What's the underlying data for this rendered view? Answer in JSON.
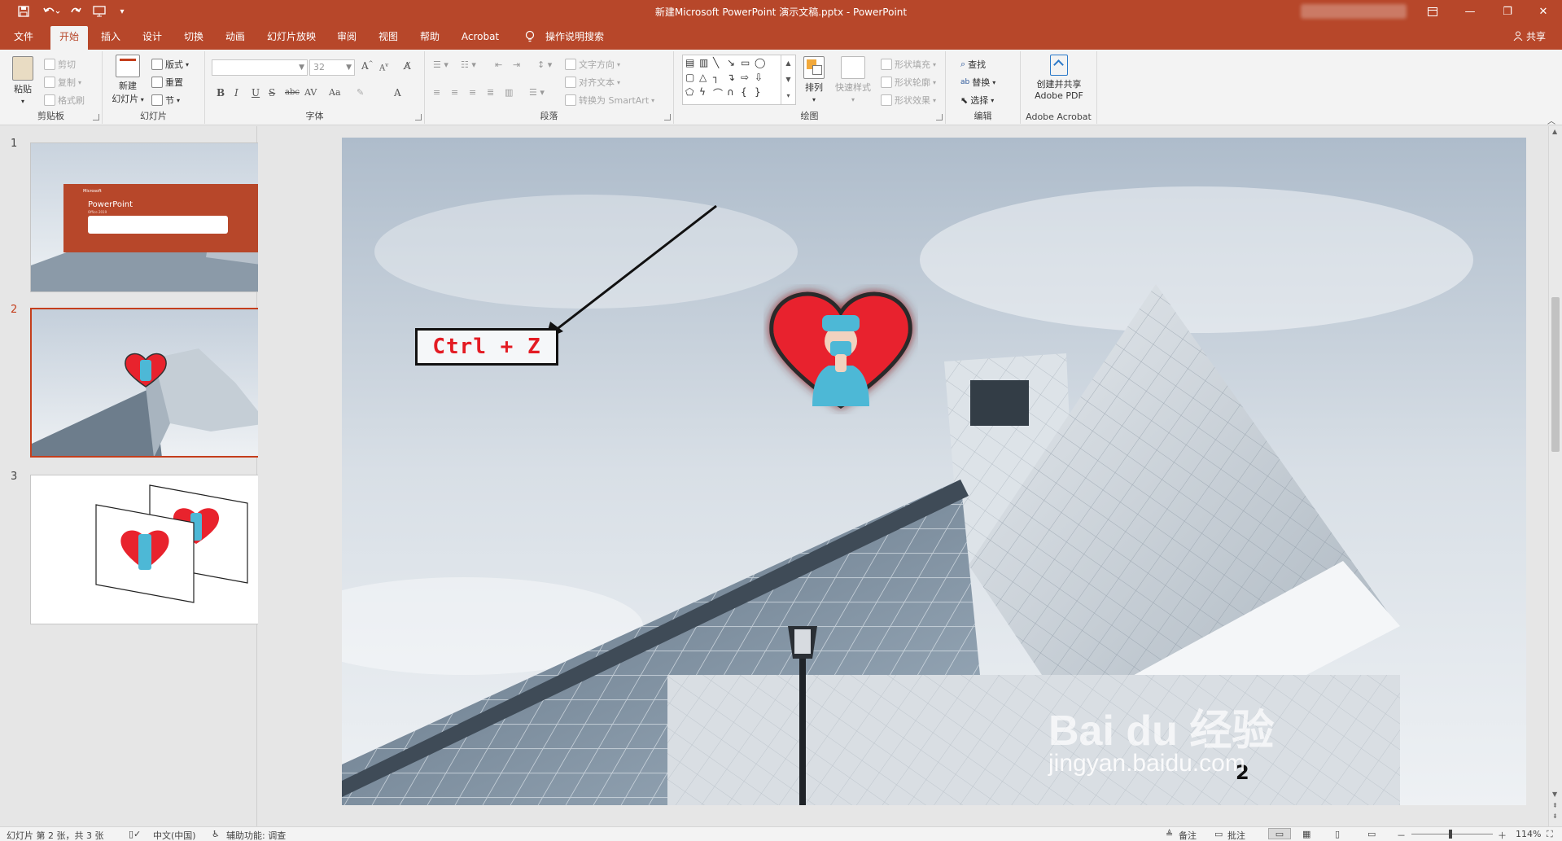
{
  "window": {
    "title": "新建Microsoft PowerPoint 演示文稿.pptx  -  PowerPoint",
    "icons": [
      "save-icon",
      "undo-icon",
      "redo-icon",
      "present-from-start-icon",
      "customize-qat-icon",
      "ribbon-display-icon",
      "minimize-icon",
      "restore-icon",
      "close-icon"
    ],
    "minimize": "—",
    "restore": "❐",
    "close": "✕"
  },
  "tabs": [
    "文件",
    "开始",
    "插入",
    "设计",
    "切换",
    "动画",
    "幻灯片放映",
    "审阅",
    "视图",
    "帮助",
    "Acrobat",
    "操作说明搜索"
  ],
  "active_tab": "开始",
  "share_label": "共享",
  "ribbon": {
    "clipboard": {
      "paste": "粘贴",
      "cut": "剪切",
      "copy": "复制",
      "format_painter": "格式刷",
      "label": "剪贴板"
    },
    "slides": {
      "new_slide_line1": "新建",
      "new_slide_line2": "幻灯片",
      "layout": "版式",
      "reset": "重置",
      "section": "节",
      "label": "幻灯片"
    },
    "font": {
      "font_name": "",
      "font_size": "32",
      "label": "字体",
      "buttons": [
        "B",
        "I",
        "U",
        "S",
        "abc",
        "AV",
        "Aa",
        "A"
      ]
    },
    "paragraph": {
      "text_direction": "文字方向",
      "align_text": "对齐文本",
      "convert_smartart": "转换为 SmartArt",
      "label": "段落"
    },
    "drawing": {
      "arrange": "排列",
      "quick_styles": "快速样式",
      "shape_fill": "形状填充",
      "shape_outline": "形状轮廓",
      "shape_effects": "形状效果",
      "label": "绘图"
    },
    "editing": {
      "find": "查找",
      "replace": "替换",
      "select": "选择",
      "label": "编辑"
    },
    "acrobat": {
      "create_line1": "创建并共享",
      "create_line2": "Adobe PDF",
      "label": "Adobe Acrobat"
    }
  },
  "thumbnails": [
    {
      "number": "1",
      "title": "PowerPoint",
      "subtitle": "Office 2019",
      "brand": "Microsoft",
      "selected": false
    },
    {
      "number": "2",
      "selected": true
    },
    {
      "number": "3",
      "selected": false
    }
  ],
  "slide": {
    "shortcut_text": "Ctrl + Z",
    "page_number": "2",
    "watermark_logo": "Bai du 经验",
    "watermark_url": "jingyan.baidu.com"
  },
  "statusbar": {
    "slide_info": "幻灯片 第 2 张，共 3 张",
    "language": "中文(中国)",
    "accessibility": "辅助功能: 调查",
    "notes": "备注",
    "comments": "批注",
    "zoom": "114%",
    "zoom_minus": "－",
    "zoom_plus": "＋"
  },
  "colors": {
    "accent": "#b7472a",
    "selection": "#c43e1c",
    "heart": "#e8232d",
    "scrub": "#4db8d6"
  }
}
